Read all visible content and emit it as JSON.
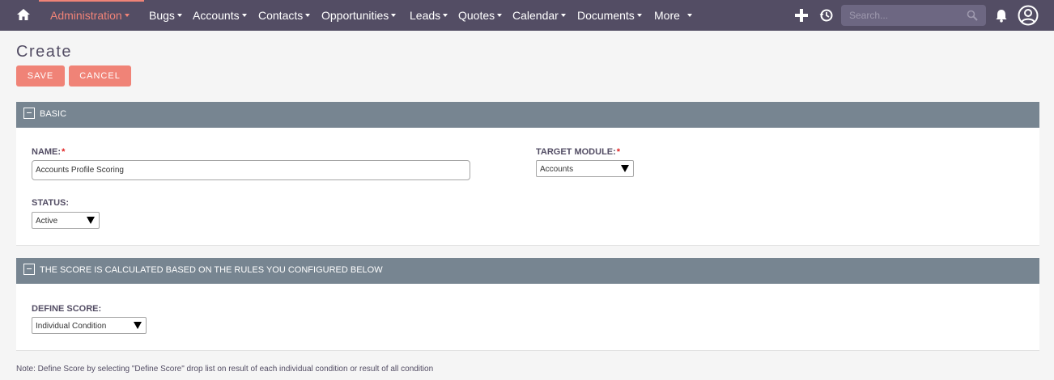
{
  "nav": {
    "items": [
      {
        "label": "Administration",
        "active": true
      },
      {
        "label": "Bugs"
      },
      {
        "label": "Accounts"
      },
      {
        "label": "Contacts"
      },
      {
        "label": "Opportunities"
      },
      {
        "label": "Leads"
      },
      {
        "label": "Quotes"
      },
      {
        "label": "Calendar"
      },
      {
        "label": "Documents"
      },
      {
        "label": "More"
      }
    ],
    "search_placeholder": "Search...",
    "icons": [
      "home-icon",
      "plus-icon",
      "history-icon",
      "search-icon",
      "bell-icon",
      "user-icon"
    ]
  },
  "page": {
    "title": "Create",
    "save_label": "SAVE",
    "cancel_label": "CANCEL"
  },
  "basic_panel": {
    "title": "BASIC",
    "name_label": "NAME:",
    "name_value": "Accounts Profile Scoring",
    "target_module_label": "TARGET MODULE:",
    "target_module_value": "Accounts",
    "status_label": "STATUS:",
    "status_value": "Active",
    "required_mark": "*"
  },
  "score_panel": {
    "title": "THE SCORE IS CALCULATED BASED ON THE RULES YOU CONFIGURED BELOW",
    "define_score_label": "DEFINE SCORE:",
    "define_score_value": "Individual Condition"
  },
  "note": "Note: Define Score by selecting \"Define Score\" drop list on result of each individual condition or result of all condition",
  "colors": {
    "nav_bg": "#534d64",
    "accent": "#f08377",
    "panel_header": "#778591",
    "page_bg": "#f5f5f5"
  }
}
